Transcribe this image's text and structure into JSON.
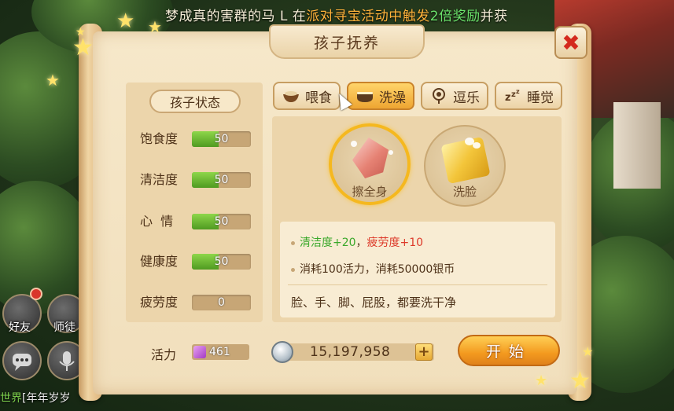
{
  "background": {
    "chat_ticker": {
      "part1": "梦成真的害群的马",
      "part2": " L 在",
      "part3": "派对寻宝活动中触发",
      "part4": "2倍奖励",
      "part5": "并获"
    },
    "sidebar": {
      "friends_label": "好友",
      "mentor_label": "师徒"
    },
    "bottom_chat": {
      "channel": "世界",
      "text": "[年年岁岁"
    }
  },
  "dialog": {
    "title": "孩子抚养",
    "close_symbol": "✖",
    "stats": {
      "header": "孩子状态",
      "items": [
        {
          "label": "饱食度",
          "value": "50",
          "fill": 0.45
        },
        {
          "label": "清洁度",
          "value": "50",
          "fill": 0.45
        },
        {
          "label": "心  情",
          "value": "50",
          "fill": 0.45
        },
        {
          "label": "健康度",
          "value": "50",
          "fill": 0.45
        },
        {
          "label": "疲劳度",
          "value": "0",
          "fill": 0
        }
      ]
    },
    "tabs": [
      {
        "label": "喂食",
        "icon": "bowl-icon",
        "active": false
      },
      {
        "label": "洗澡",
        "icon": "bathtub-icon",
        "active": true
      },
      {
        "label": "逗乐",
        "icon": "rattle-icon",
        "active": false
      },
      {
        "label": "睡觉",
        "icon": "sleep-icon",
        "active": false
      }
    ],
    "options": [
      {
        "label": "擦全身",
        "icon": "soap-bar-icon",
        "selected": true
      },
      {
        "label": "洗脸",
        "icon": "sponge-icon",
        "selected": false
      }
    ],
    "description": {
      "effect_clean_label": "清洁度",
      "effect_clean_value": "+20",
      "separator": "，",
      "effect_fatigue_label": "疲劳度",
      "effect_fatigue_value": "+10",
      "cost": "消耗100活力，消耗50000银币",
      "hint": "脸、手、脚、屁股，都要洗干净"
    },
    "vigor": {
      "label": "活力",
      "value": "461"
    },
    "silver": {
      "value": "15,197,958",
      "plus": "+"
    },
    "start_label": "开始"
  },
  "colors": {
    "accent_orange": "#f39a1f",
    "stat_green": "#6cc23a",
    "effect_green": "#3aa82a",
    "effect_red": "#dd3a2a",
    "close_red": "#d42a1e"
  }
}
